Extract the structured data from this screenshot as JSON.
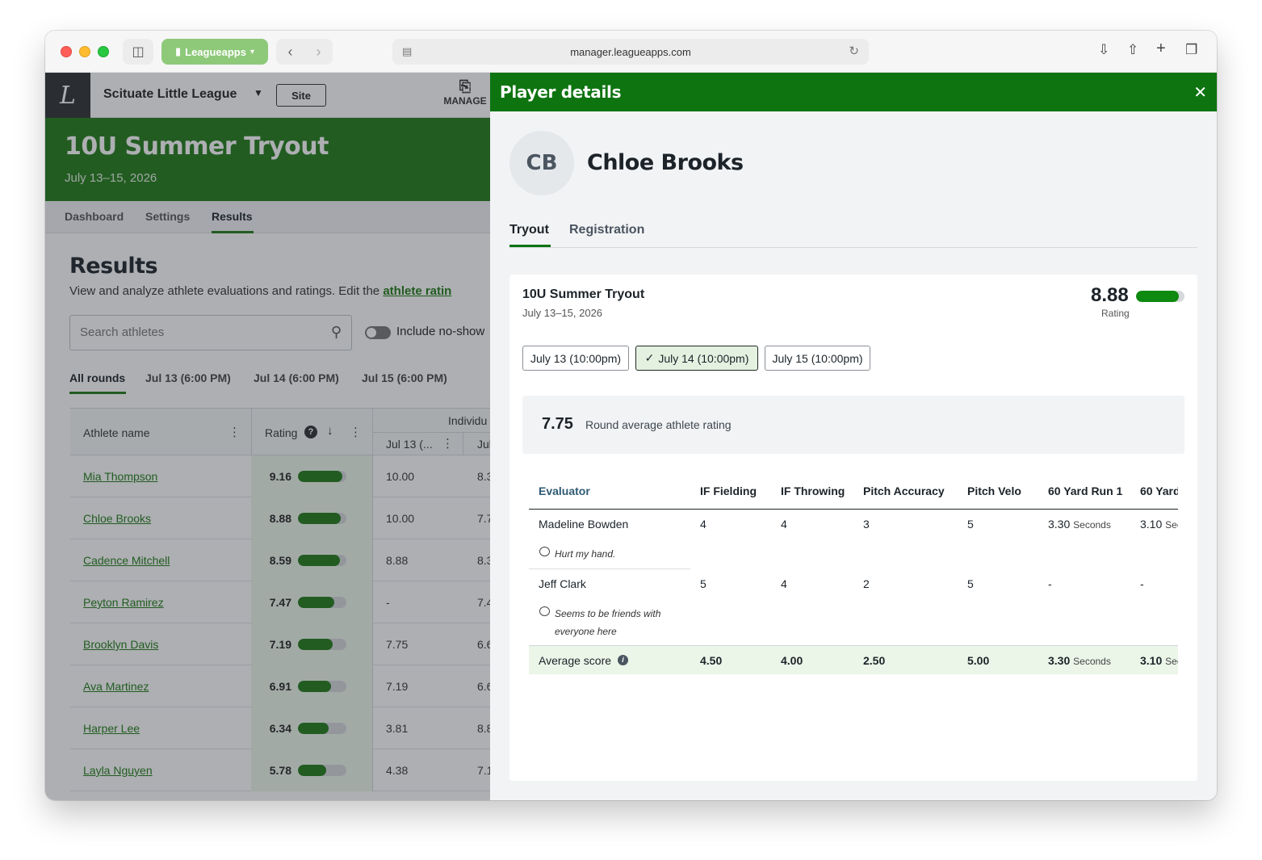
{
  "browser": {
    "tab_group_label": "Leagueapps",
    "url": "manager.leagueapps.com"
  },
  "app": {
    "org_name": "Scituate Little League",
    "site_button": "Site",
    "manage_label": "MANAGE",
    "event_title": "10U Summer Tryout",
    "event_dates": "July 13–15, 2026",
    "subnav": [
      "Dashboard",
      "Settings",
      "Results"
    ],
    "results_title": "Results",
    "results_desc": "View and analyze athlete evaluations and ratings. Edit the",
    "results_link": "athlete ratin",
    "search_placeholder": "Search athletes",
    "toggle_label": "Include no-show",
    "rounds": [
      "All rounds",
      "Jul 13 (6:00 PM)",
      "Jul 14 (6:00 PM)",
      "Jul 15 (6:00 PM)"
    ],
    "grid_headers": {
      "name": "Athlete name",
      "rating": "Rating",
      "individual": "Individu",
      "jul13": "Jul 13 (...",
      "jul14": "Jul"
    },
    "athletes": [
      {
        "name": "Mia Thompson",
        "rating": "9.16",
        "pct": 0.916,
        "r1": "10.00",
        "r2": "8.3"
      },
      {
        "name": "Chloe Brooks",
        "rating": "8.88",
        "pct": 0.888,
        "r1": "10.00",
        "r2": "7.7"
      },
      {
        "name": "Cadence Mitchell",
        "rating": "8.59",
        "pct": 0.859,
        "r1": "8.88",
        "r2": "8.3"
      },
      {
        "name": "Peyton Ramirez",
        "rating": "7.47",
        "pct": 0.747,
        "r1": "-",
        "r2": "7.4"
      },
      {
        "name": "Brooklyn Davis",
        "rating": "7.19",
        "pct": 0.719,
        "r1": "7.75",
        "r2": "6.6"
      },
      {
        "name": "Ava Martinez",
        "rating": "6.91",
        "pct": 0.691,
        "r1": "7.19",
        "r2": "6.6"
      },
      {
        "name": "Harper Lee",
        "rating": "6.34",
        "pct": 0.634,
        "r1": "3.81",
        "r2": "8.8"
      },
      {
        "name": "Layla Nguyen",
        "rating": "5.78",
        "pct": 0.578,
        "r1": "4.38",
        "r2": "7.1"
      }
    ]
  },
  "panel": {
    "title": "Player details",
    "initials": "CB",
    "player_name": "Chloe Brooks",
    "tabs": [
      "Tryout",
      "Registration"
    ],
    "tryout_title": "10U Summer Tryout",
    "tryout_dates": "July 13–15, 2026",
    "rating": "8.88",
    "rating_pct": 0.888,
    "rating_label": "Rating",
    "rounds": [
      "July 13 (10:00pm)",
      "July 14 (10:00pm)",
      "July 15 (10:00pm)"
    ],
    "selected_round_index": 1,
    "round_avg_value": "7.75",
    "round_avg_label": "Round average athlete rating",
    "columns": [
      "Evaluator",
      "IF Fielding",
      "IF Throwing",
      "Pitch Accuracy",
      "Pitch Velo",
      "60 Yard Run 1",
      "60 Yard"
    ],
    "evaluations": [
      {
        "evaluator": "Madeline Bowden",
        "if_fielding": "4",
        "if_throwing": "4",
        "pitch_accuracy": "3",
        "pitch_velo": "5",
        "run1": "3.30",
        "run1_unit": "Seconds",
        "run2": "3.10",
        "run2_unit": "Sec",
        "comment": "Hurt my hand."
      },
      {
        "evaluator": "Jeff Clark",
        "if_fielding": "5",
        "if_throwing": "4",
        "pitch_accuracy": "2",
        "pitch_velo": "5",
        "run1": "-",
        "run2": "-",
        "comment_line1": "Seems to be friends with",
        "comment_line2": "everyone here"
      }
    ],
    "average": {
      "label": "Average score",
      "if_fielding": "4.50",
      "if_throwing": "4.00",
      "pitch_accuracy": "2.50",
      "pitch_velo": "5.00",
      "run1": "3.30",
      "run1_unit": "Seconds",
      "run2": "3.10",
      "run2_unit": "Sec"
    }
  }
}
